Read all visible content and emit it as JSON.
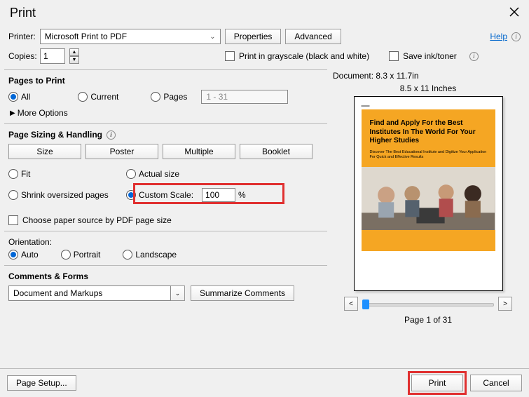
{
  "title": "Print",
  "help": "Help",
  "printer": {
    "label": "Printer:",
    "value": "Microsoft Print to PDF",
    "properties": "Properties",
    "advanced": "Advanced"
  },
  "copies": {
    "label": "Copies:",
    "value": "1"
  },
  "grayscale": "Print in grayscale (black and white)",
  "saveink": "Save ink/toner",
  "pagesToPrint": {
    "title": "Pages to Print",
    "all": "All",
    "current": "Current",
    "pages": "Pages",
    "range": "1 - 31",
    "more": "More Options"
  },
  "sizing": {
    "title": "Page Sizing & Handling",
    "size": "Size",
    "poster": "Poster",
    "multiple": "Multiple",
    "booklet": "Booklet",
    "fit": "Fit",
    "actual": "Actual size",
    "shrink": "Shrink oversized pages",
    "custom": "Custom Scale:",
    "scale_value": "100",
    "pct": "%",
    "choose": "Choose paper source by PDF page size"
  },
  "orientation": {
    "title": "Orientation:",
    "auto": "Auto",
    "portrait": "Portrait",
    "landscape": "Landscape"
  },
  "comments": {
    "title": "Comments & Forms",
    "value": "Document and Markups",
    "summarize": "Summarize Comments"
  },
  "preview": {
    "doc": "Document: 8.3 x 11.7in",
    "paper": "8.5 x 11 Inches",
    "hero_title": "Find and Apply For the Best Institutes In The World For Your Higher Studies",
    "hero_sub": "Discover The Best Educational Institute and Digitize Your Application For Quick and Effective Results",
    "page_of": "Page 1 of 31"
  },
  "footer": {
    "pagesetup": "Page Setup...",
    "print": "Print",
    "cancel": "Cancel"
  }
}
